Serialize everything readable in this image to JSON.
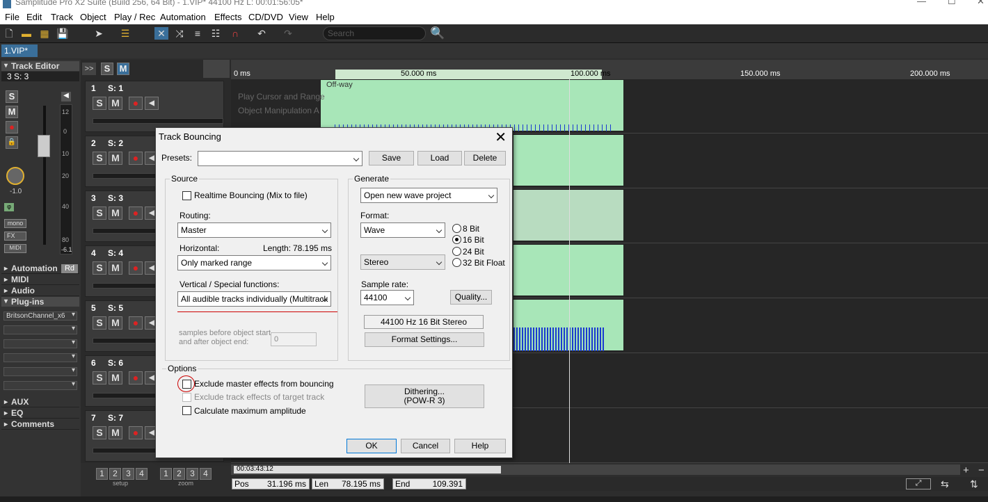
{
  "window": {
    "title": "Samplitude Pro X2 Suite (Build 256, 64 Bit)  -  1.VIP*  44100 Hz L: 00:01:56:05*"
  },
  "menu": [
    "File",
    "Edit",
    "Track",
    "Object",
    "Play / Rec",
    "Automation",
    "Effects",
    "CD/DVD",
    "View",
    "Help"
  ],
  "search": {
    "placeholder": "Search"
  },
  "project_tab": "1.VIP*",
  "left_panel": {
    "track_editor": "Track Editor",
    "track_selector": "3   S: 3",
    "volume_db": "-1.0",
    "meter_top": "12",
    "meter_labels": [
      "0",
      "10",
      "20",
      "40",
      "80"
    ],
    "meter_bottom": "-6.1",
    "mono": "mono",
    "fx": "FX",
    "midi_btn": "MIDI",
    "automation": "Automation",
    "automation_mode": "Rd",
    "sections": [
      "MIDI",
      "Audio"
    ],
    "plugins": "Plug-ins",
    "plugin_slot": "BritsonChannel_x6",
    "aux": "AUX",
    "eq": "EQ",
    "comments": "Comments"
  },
  "tracks": [
    {
      "num": "1",
      "name": "S: 1"
    },
    {
      "num": "2",
      "name": "S: 2"
    },
    {
      "num": "3",
      "name": "S: 3"
    },
    {
      "num": "4",
      "name": "S: 4"
    },
    {
      "num": "5",
      "name": "S: 5"
    },
    {
      "num": "6",
      "name": "S: 6"
    },
    {
      "num": "7",
      "name": "S: 7"
    }
  ],
  "track_buttons": {
    "s": "S",
    "m": "M"
  },
  "toggle_top": {
    "collapse": ">>",
    "s": "S",
    "m": "M"
  },
  "ruler": [
    "0 ms",
    "50.000 ms",
    "100.000 ms",
    "150.000 ms",
    "200.000 ms"
  ],
  "overlay_text": [
    "Play Cursor and Range",
    "Object Manipulation A"
  ],
  "clip_label": "Off-way",
  "setup": {
    "nums": [
      "1",
      "2",
      "3",
      "4"
    ],
    "label": "setup"
  },
  "zoom": {
    "nums": [
      "1",
      "2",
      "3",
      "4"
    ],
    "label": "zoom"
  },
  "timecode": "00:03:43:12",
  "status": {
    "pos_label": "Pos",
    "pos": "31.196 ms",
    "len_label": "Len",
    "len": "78.195 ms",
    "end_label": "End",
    "end": "109.391"
  },
  "dialog": {
    "title": "Track Bouncing",
    "presets_label": "Presets:",
    "presets_value": "",
    "save": "Save",
    "load": "Load",
    "delete": "Delete",
    "source": {
      "label": "Source",
      "realtime": "Realtime Bouncing (Mix to file)",
      "routing_label": "Routing:",
      "routing": "Master",
      "horizontal_label": "Horizontal:",
      "length_label": "Length:",
      "length": "78.195 ms",
      "horizontal": "Only marked range",
      "vertical_label": "Vertical / Special functions:",
      "vertical": "All audible tracks individually  (Multitrack Bounce)",
      "samples_label_1": "samples before object start",
      "samples_label_2": "and after object end:",
      "samples_value": "0"
    },
    "generate": {
      "label": "Generate",
      "target": "Open new wave project",
      "format_label": "Format:",
      "format": "Wave",
      "bits": [
        "8 Bit",
        "16 Bit",
        "24 Bit",
        "32 Bit Float"
      ],
      "bits_selected": "16 Bit",
      "channels": "Stereo",
      "sample_rate_label": "Sample rate:",
      "sample_rate": "44100",
      "quality": "Quality...",
      "summary": "44100 Hz  16 Bit  Stereo",
      "format_settings": "Format Settings..."
    },
    "options": {
      "label": "Options",
      "exclude_master": "Exclude master effects from bouncing",
      "exclude_track": "Exclude track effects of target track",
      "calc_amp": "Calculate maximum amplitude",
      "dithering_1": "Dithering...",
      "dithering_2": "(POW-R 3)"
    },
    "ok": "OK",
    "cancel": "Cancel",
    "help": "Help"
  }
}
